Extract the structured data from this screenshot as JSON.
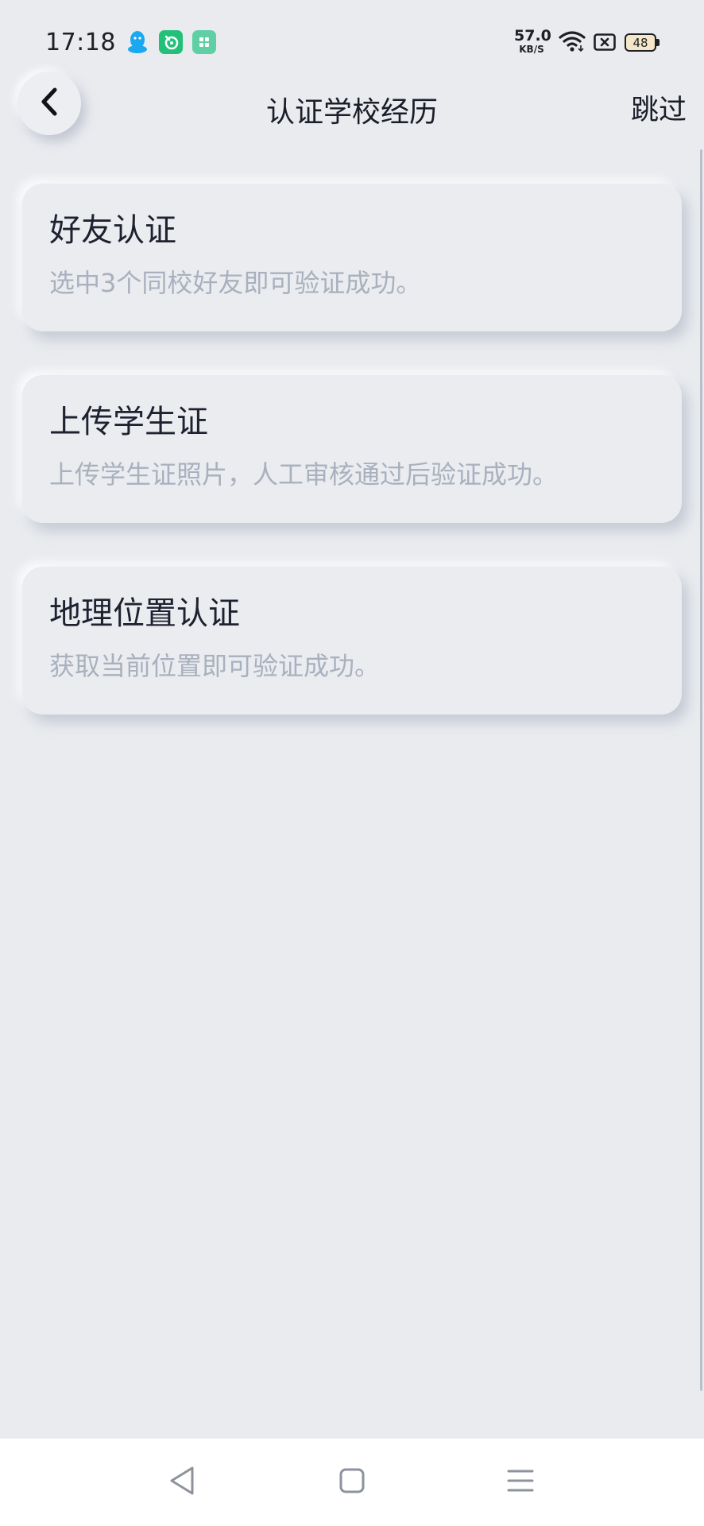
{
  "status_bar": {
    "time": "17:18",
    "notification_icons": [
      "qq-icon",
      "green-app-icon",
      "teal-app-icon"
    ],
    "net_speed_value": "57.0",
    "net_speed_unit": "KB/S",
    "wifi_icon": "wifi-icon",
    "sim_icon": "no-sim-icon",
    "battery_level": "48"
  },
  "header": {
    "back_icon": "chevron-left-icon",
    "title": "认证学校经历",
    "skip_label": "跳过"
  },
  "options": [
    {
      "title": "好友认证",
      "description": "选中3个同校好友即可验证成功。"
    },
    {
      "title": "上传学生证",
      "description": "上传学生证照片，人工审核通过后验证成功。"
    },
    {
      "title": "地理位置认证",
      "description": "获取当前位置即可验证成功。"
    }
  ],
  "nav_bar": {
    "back_icon": "triangle-back-icon",
    "home_icon": "square-home-icon",
    "menu_icon": "hamburger-menu-icon"
  },
  "colors": {
    "background": "#e9ebef",
    "card_title": "#1e2230",
    "card_description": "#a9b0be",
    "qq_blue": "#1aa8f0",
    "app_green": "#23c07a",
    "app_teal": "#5fcfa6"
  }
}
